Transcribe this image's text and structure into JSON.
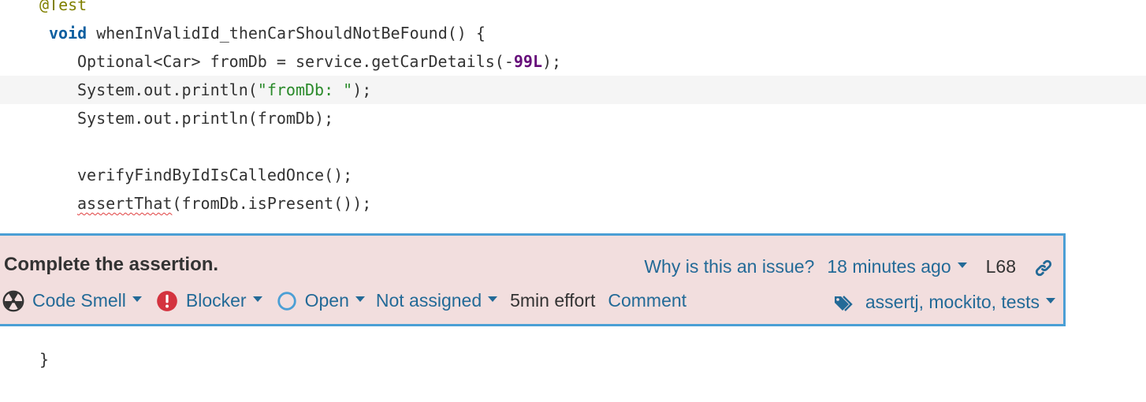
{
  "code": {
    "annotation": "@Test",
    "method_kw": "void",
    "method_sig": " whenInValidId_thenCarShouldNotBeFound() {",
    "line_optional_a": "Optional<Car> fromDb = service.getCarDetails(-",
    "line_optional_num": "99L",
    "line_optional_b": ");",
    "line_print1_a": "System.out.println(",
    "line_print1_str": "\"fromDb: \"",
    "line_print1_b": ");",
    "line_print2": "System.out.println(fromDb);",
    "line_verify": "verifyFindByIdIsCalledOnce();",
    "line_assert_squiggle": "assertThat",
    "line_assert_rest": "(fromDb.isPresent());",
    "closing_brace": "}"
  },
  "issue": {
    "message": "Complete the assertion.",
    "why_link": "Why is this an issue?",
    "time_ago": "18 minutes ago",
    "line_ref": "L68",
    "type": "Code Smell",
    "severity": "Blocker",
    "status": "Open",
    "assignee": "Not assigned",
    "effort": "5min effort",
    "comment": "Comment",
    "tags": "assertj, mockito, tests",
    "icons": {
      "type": "code-smell-icon",
      "severity": "blocker-icon",
      "status": "open-status-icon",
      "permalink": "link-icon",
      "tags": "tags-icon"
    },
    "colors": {
      "link": "#236a97",
      "background": "#f2dede",
      "border": "#4b9fd5",
      "blocker": "#d4333f"
    }
  }
}
